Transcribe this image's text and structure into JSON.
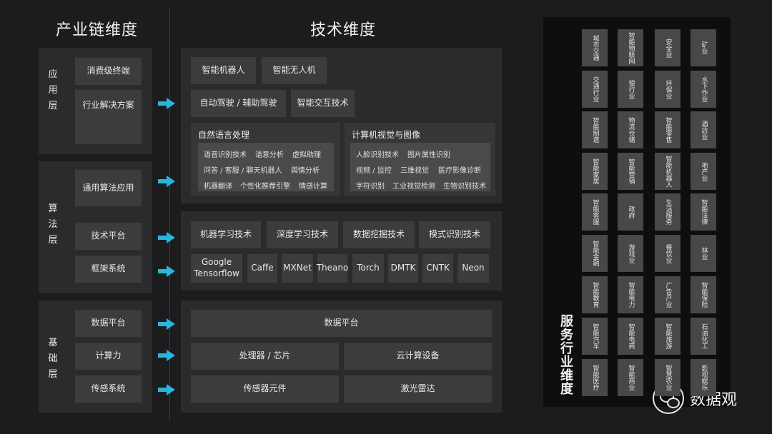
{
  "headings": {
    "industry_chain": "产业链维度",
    "technology": "技术维度",
    "service": "服务行业维度"
  },
  "layers": {
    "application": {
      "label": [
        "应",
        "用",
        "层"
      ],
      "items": [
        "消费级终端",
        "行业解决方案"
      ]
    },
    "algorithm": {
      "label": [
        "算",
        "法",
        "层"
      ],
      "items": [
        "通用算法应用",
        "技术平台",
        "框架系统"
      ]
    },
    "foundation": {
      "label": [
        "基",
        "础",
        "层"
      ],
      "items": [
        "数据平台",
        "计算力",
        "传感系统"
      ]
    }
  },
  "tech": {
    "app": {
      "row1": [
        "智能机器人",
        "智能无人机"
      ],
      "row2": [
        "自动驾驶 / 辅助驾驶",
        "智能交互技术"
      ],
      "nlp": {
        "title": "自然语言处理",
        "tags": [
          [
            "语音识别技术",
            "语意分析",
            "虚拟助理"
          ],
          [
            "问答 / 客服 / 聊天机器人",
            "舆情分析"
          ],
          [
            "机器翻译",
            "个性化推荐引擎",
            "情感计算"
          ]
        ]
      },
      "cv": {
        "title": "计算机视觉与图像",
        "tags": [
          [
            "人脸识别技术",
            "图片属性识别"
          ],
          [
            "视频 / 监控",
            "三维视觉",
            "医疗影像诊断"
          ],
          [
            "字符识别",
            "工业视觉检测",
            "生物识别技术"
          ]
        ]
      }
    },
    "algorithm": {
      "techs": [
        "机器学习技术",
        "深度学习技术",
        "数据挖掘技术",
        "模式识别技术"
      ],
      "frameworks": [
        "Google Tensorflow",
        "Caffe",
        "MXNet",
        "Theano",
        "Torch",
        "DMTK",
        "CNTK",
        "Neon"
      ]
    },
    "foundation": {
      "data": "数据平台",
      "compute": [
        "处理器 / 芯片",
        "云计算设备"
      ],
      "sensor": [
        "传感器元件",
        "激光雷达"
      ]
    }
  },
  "industries": [
    [
      "城市交通",
      "智能物联网",
      "安全业",
      "矿业"
    ],
    [
      "交通行业",
      "银行业",
      "环保业",
      "水下作业"
    ],
    [
      "智能制造",
      "物流仓储",
      "智能零售",
      "酒店业"
    ],
    [
      "智能家居",
      "智能营销",
      "智能机器人",
      "地产业"
    ],
    [
      "智能客服",
      "政府",
      "生活服务",
      "智能法律"
    ],
    [
      "智能金融",
      "游戏业",
      "餐饮业",
      "林业"
    ],
    [
      "智能教育",
      "智能电力",
      "广告产业",
      "智能保险"
    ],
    [
      "智能汽车",
      "智能电商",
      "智能旅游",
      "石油化工"
    ],
    [
      "智能医疗",
      "智能商业",
      "智慧农业",
      "影视娱乐"
    ]
  ],
  "watermark": "数据观",
  "colors": {
    "arrow": "#27b6de"
  }
}
